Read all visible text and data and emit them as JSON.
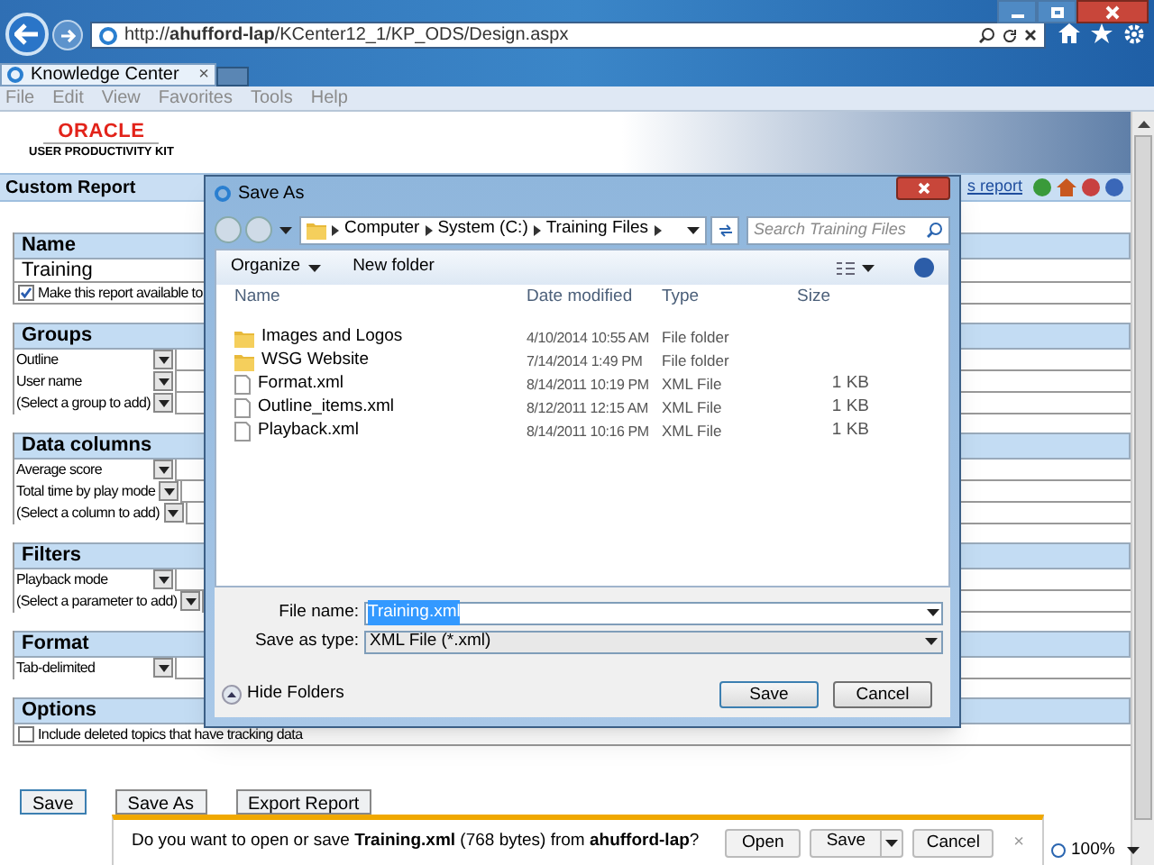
{
  "browser": {
    "url": "http://**ahufford-lap**/KCenter12_1/KP_ODS/Design.aspx",
    "tab": {
      "title": "Knowledge Center",
      "close": "×"
    },
    "menu": [
      "File",
      "Edit",
      "View",
      "Favorites",
      "Tools",
      "Help"
    ]
  },
  "page": {
    "logo": {
      "brand": "ORACLE",
      "product": "USER PRODUCTIVITY KIT"
    },
    "header": {
      "title": "Custom Report",
      "link": "s report"
    },
    "sections": [
      {
        "title": "Name",
        "rows": [
          {
            "kind": "text",
            "value": "Training"
          },
          {
            "kind": "checkbox",
            "label": "Make this report available to",
            "checked": true
          }
        ]
      },
      {
        "title": "Groups",
        "rows": [
          {
            "kind": "select",
            "value": "Outline"
          },
          {
            "kind": "select",
            "value": "User name"
          },
          {
            "kind": "select",
            "value": "(Select a group to add)"
          }
        ]
      },
      {
        "title": "Data columns",
        "rows": [
          {
            "kind": "select",
            "value": "Average score"
          },
          {
            "kind": "select",
            "value": "Total time by play mode"
          },
          {
            "kind": "select",
            "value": "(Select a column to add)"
          }
        ]
      },
      {
        "title": "Filters",
        "rows": [
          {
            "kind": "select",
            "value": "Playback mode"
          },
          {
            "kind": "select",
            "value": "(Select a parameter to add)"
          }
        ]
      },
      {
        "title": "Format",
        "rows": [
          {
            "kind": "select",
            "value": "Tab-delimited"
          }
        ]
      },
      {
        "title": "Options",
        "rows": [
          {
            "kind": "checkbox",
            "label": "Include deleted topics that have tracking data",
            "checked": false
          }
        ]
      }
    ],
    "buttons": [
      "Save",
      "Save As",
      "Export Report"
    ]
  },
  "dialog": {
    "title": "Save As",
    "breadcrumb": [
      "Computer",
      "System (C:)",
      "Training Files"
    ],
    "search": {
      "placeholder": "Search Training Files"
    },
    "toolbar": [
      "Organize",
      "New folder"
    ],
    "columns": [
      "Name",
      "Date modified",
      "Type",
      "Size"
    ],
    "files": [
      {
        "kind": "folder",
        "name": "Images and Logos",
        "date": "4/10/2014 10:55 AM",
        "type": "File folder"
      },
      {
        "kind": "folder",
        "name": "WSG Website",
        "date": "7/14/2014 1:49 PM",
        "type": "File folder"
      },
      {
        "kind": "file",
        "name": "Format.xml",
        "date": "8/14/2011 10:19 PM",
        "type": "XML File",
        "size": "1 KB"
      },
      {
        "kind": "file",
        "name": "Outline_items.xml",
        "date": "8/12/2011 12:15 AM",
        "type": "XML File",
        "size": "1 KB"
      },
      {
        "kind": "file",
        "name": "Playback.xml",
        "date": "8/14/2011 10:16 PM",
        "type": "XML File",
        "size": "1 KB"
      }
    ],
    "file_name": {
      "label": "File name:",
      "value": "Training.xml",
      "selected": true
    },
    "save_type": {
      "label": "Save as type:",
      "value": "XML File (*.xml)"
    },
    "hide_folders": "Hide Folders",
    "buttons": [
      "Save",
      "Cancel"
    ]
  },
  "notification": {
    "message": "Do you want to open or save **Training.xml** (768 bytes) from **ahufford-lap**?",
    "buttons": [
      "Open",
      "Save",
      "Cancel"
    ],
    "close": "×"
  },
  "status": {
    "zoom": "100%"
  }
}
